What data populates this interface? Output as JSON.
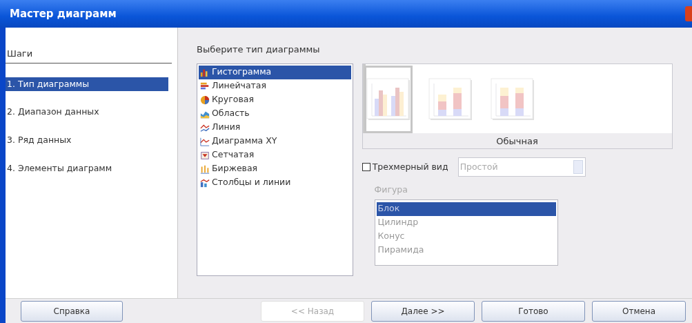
{
  "window": {
    "title": "Мастер диаграмм"
  },
  "steps": {
    "heading": "Шаги",
    "items": [
      {
        "label": "1. Тип диаграммы",
        "selected": true
      },
      {
        "label": "2. Диапазон данных",
        "selected": false
      },
      {
        "label": "3. Ряд данных",
        "selected": false
      },
      {
        "label": "4. Элементы диаграмм",
        "selected": false
      }
    ]
  },
  "chart_types": {
    "heading": "Выберите тип диаграммы",
    "items": [
      {
        "label": "Гистограмма",
        "kind": "column",
        "selected": true
      },
      {
        "label": "Линейчатая",
        "kind": "bar",
        "selected": false
      },
      {
        "label": "Круговая",
        "kind": "pie",
        "selected": false
      },
      {
        "label": "Область",
        "kind": "area",
        "selected": false
      },
      {
        "label": "Линия",
        "kind": "line",
        "selected": false
      },
      {
        "label": "Диаграмма XY",
        "kind": "xy",
        "selected": false
      },
      {
        "label": "Сетчатая",
        "kind": "net",
        "selected": false
      },
      {
        "label": "Биржевая",
        "kind": "stock",
        "selected": false
      },
      {
        "label": "Столбцы и линии",
        "kind": "columnline",
        "selected": false
      }
    ]
  },
  "variants": {
    "items": [
      {
        "kind": "normal",
        "selected": true
      },
      {
        "kind": "stacked",
        "selected": false
      },
      {
        "kind": "percent",
        "selected": false
      }
    ],
    "caption": "Обычная"
  },
  "view3d": {
    "label": "Трехмерный вид",
    "checked": false,
    "dropdown": {
      "value": "Простой",
      "disabled": true
    }
  },
  "shape": {
    "label": "Фигура",
    "disabled": true,
    "items": [
      {
        "label": "Блок",
        "selected": true
      },
      {
        "label": "Цилиндр",
        "selected": false
      },
      {
        "label": "Конус",
        "selected": false
      },
      {
        "label": "Пирамида",
        "selected": false
      }
    ]
  },
  "buttons": [
    {
      "label": "Справка",
      "disabled": false
    },
    {
      "label": "<< Назад",
      "disabled": true
    },
    {
      "label": "Далее >>",
      "disabled": false
    },
    {
      "label": "Готово",
      "disabled": false
    },
    {
      "label": "Отмена",
      "disabled": false
    }
  ]
}
